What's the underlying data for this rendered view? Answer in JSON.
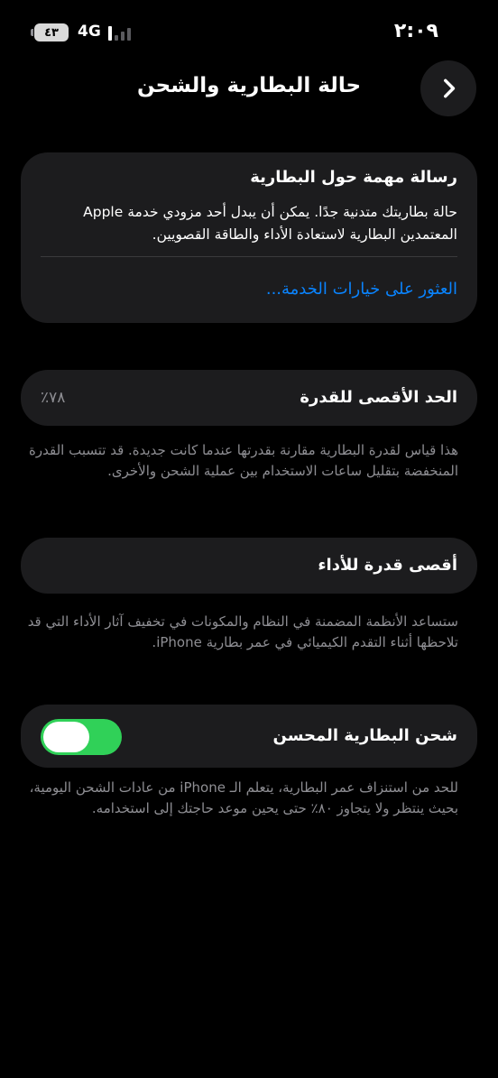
{
  "status_bar": {
    "time": "٢:٠٩",
    "network": "4G",
    "battery_level": "٤٣",
    "signal_bars_active": 1,
    "signal_bars_total": 4
  },
  "header": {
    "title": "حالة البطارية والشحن",
    "back_icon": "chevron-right-icon"
  },
  "battery_message": {
    "title": "رسالة مهمة حول البطارية",
    "body": "حالة بطاريتك متدنية جدًا. يمكن أن يبدل أحد مزودي خدمة Apple المعتمدين البطارية لاستعادة الأداء والطاقة القصويين.",
    "link": "العثور على خيارات الخدمة..."
  },
  "maximum_capacity": {
    "label": "الحد الأقصى للقدرة",
    "value": "٧٨٪",
    "footnote": "هذا قياس لقدرة البطارية مقارنة بقدرتها عندما كانت جديدة. قد تتسبب القدرة المنخفضة بتقليل ساعات الاستخدام بين عملية الشحن والأخرى."
  },
  "peak_performance": {
    "label": "أقصى قدرة للأداء",
    "footnote": "ستساعد الأنظمة المضمنة في النظام والمكونات في تخفيف آثار الأداء التي قد تلاحظها أثناء التقدم الكيميائي في عمر بطارية iPhone."
  },
  "optimized_charging": {
    "label": "شحن البطارية المحسن",
    "enabled": true,
    "footnote": "للحد من استنزاف عمر البطارية، يتعلم الـ iPhone من عادات الشحن اليومية، بحيث ينتظر ولا يتجاوز ٨٠٪ حتى يحين موعد حاجتك إلى استخدامه."
  },
  "colors": {
    "background": "#000000",
    "card": "#1c1c1e",
    "link": "#0a84ff",
    "toggle_on": "#30d158",
    "secondary_text": "#8e8e93"
  }
}
